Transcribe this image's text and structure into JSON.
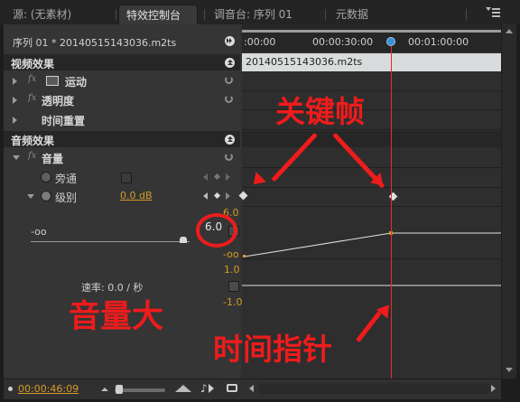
{
  "tabs": [
    {
      "label": "源: (无素材)"
    },
    {
      "label": "特效控制台 ×"
    },
    {
      "label": "调音台: 序列 01"
    },
    {
      "label": "元数据"
    }
  ],
  "panel_menu_icon": "panel-menu-icon",
  "header": {
    "sequence": "序列 01 * 20140515143036.m2ts"
  },
  "timeline": {
    "ticks": [
      ":00:00",
      "00:00:30:00",
      "00:01:00:00"
    ],
    "clip_name": "20140515143036.m2ts",
    "playhead_color": "#e0302a"
  },
  "video_effects": {
    "title": "视频效果",
    "items": [
      {
        "fx": "fx",
        "label": "运动"
      },
      {
        "fx": "fx",
        "label": "透明度"
      },
      {
        "fx": "",
        "label": "时间重置"
      }
    ]
  },
  "audio_effects": {
    "title": "音频效果",
    "volume": {
      "fx": "fx",
      "label": "音量",
      "bypass_label": "旁通",
      "level_label": "级别",
      "level_value": "0.0 dB"
    }
  },
  "graph": {
    "slider_min": "-oo",
    "slider_value": "6.0",
    "top_max": "6.0",
    "top_min": "-oo",
    "bottom_max": "1.0",
    "bottom_min": "-1.0",
    "rate_label": "速率: 0.0 / 秒",
    "level_fraction_at_playhead": 0.36
  },
  "footer": {
    "timecode": "00:00:46:09"
  },
  "annotations": {
    "keyframe": "关键帧",
    "volume_big": "音量大",
    "time_pointer": "时间指针",
    "color": "#ee1c1c"
  }
}
